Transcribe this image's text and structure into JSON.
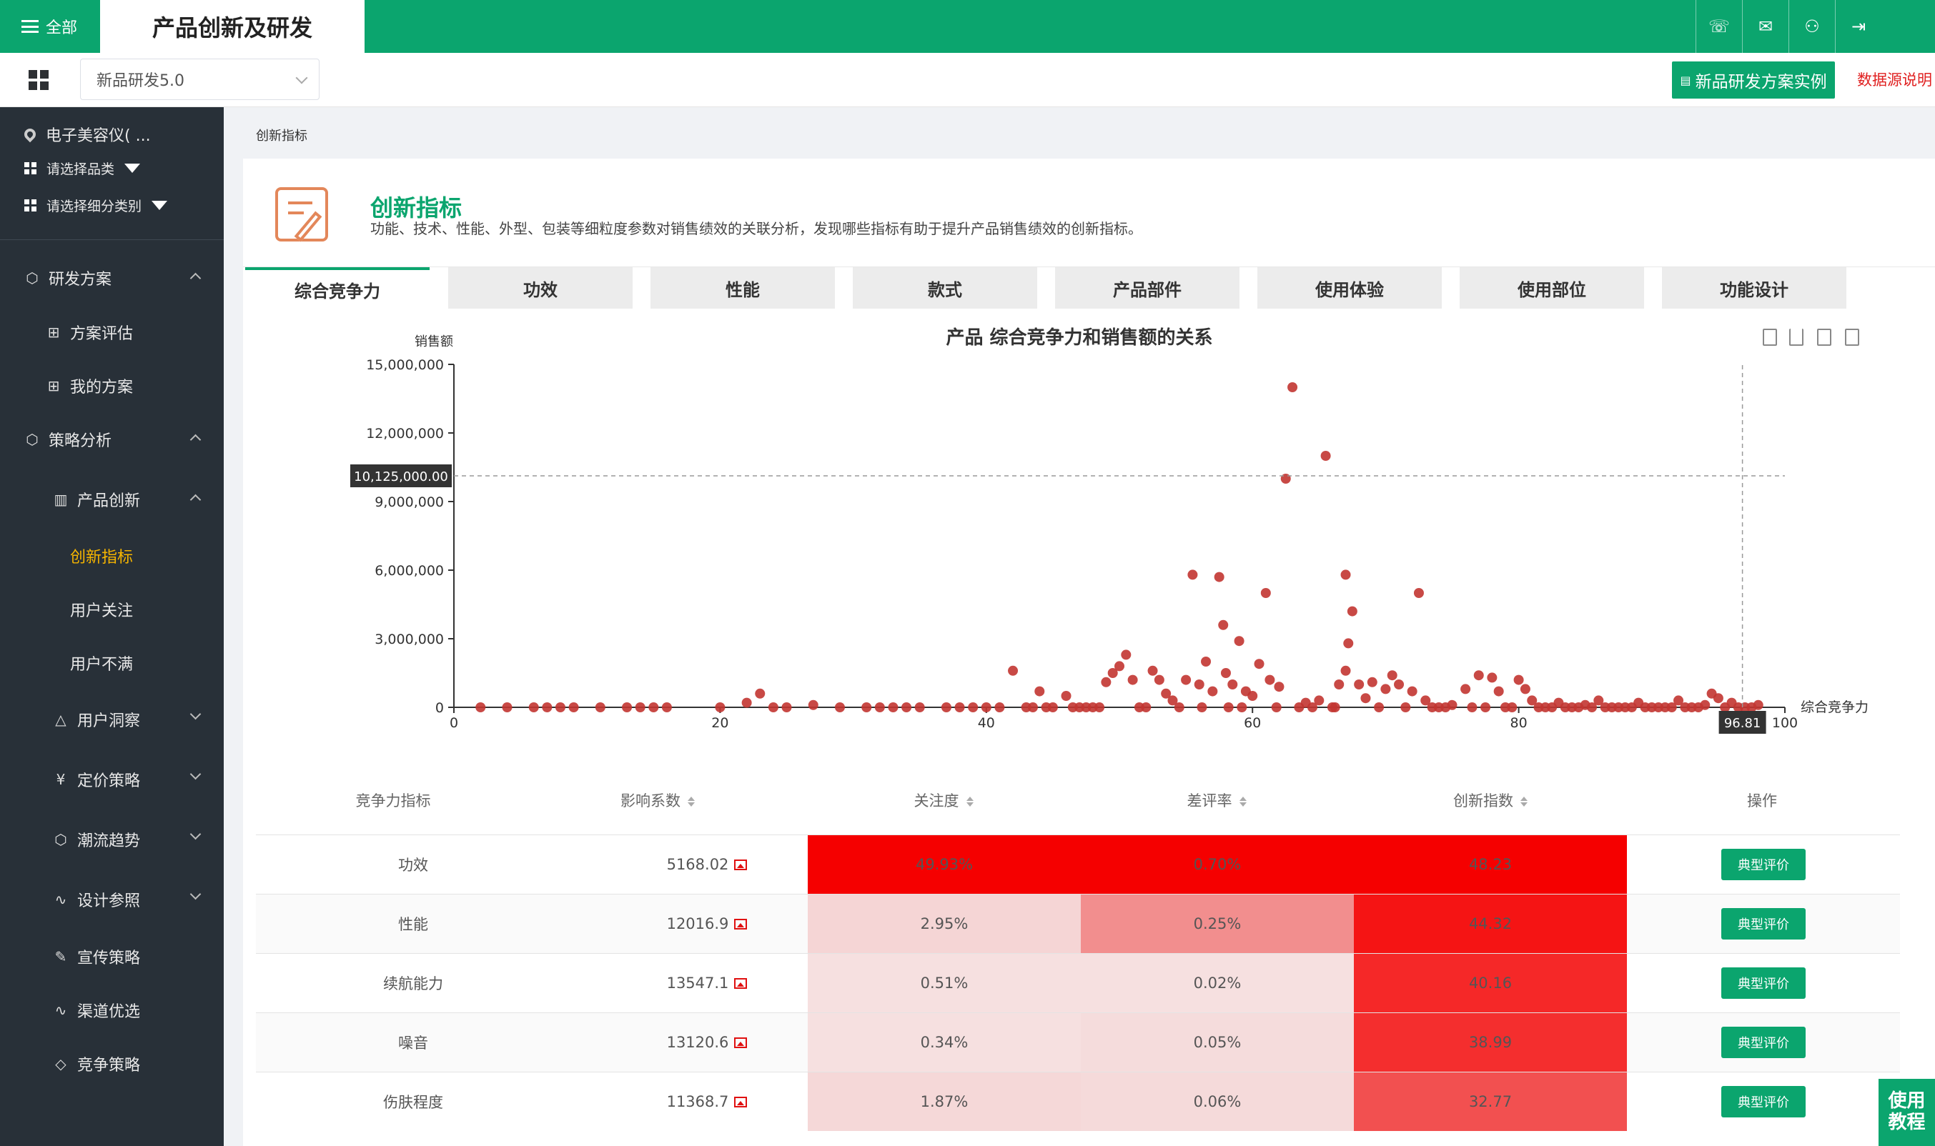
{
  "topbar": {
    "all_label": "全部",
    "app_title": "产品创新及研发",
    "icons": [
      "phone-icon",
      "wechat-icon",
      "user-icon",
      "logout-icon"
    ]
  },
  "subbar": {
    "version_value": "新品研发5.0",
    "case_button": "新品研发方案实例",
    "datasrc_link": "数据源说明"
  },
  "sidebar": {
    "location": "电子美容仪( ...",
    "select_category": "请选择品类",
    "select_subcategory": "请选择细分类别",
    "items": [
      {
        "label": "研发方案",
        "level": 1
      },
      {
        "label": "方案评估",
        "level": 2
      },
      {
        "label": "我的方案",
        "level": 2
      },
      {
        "label": "策略分析",
        "level": 1
      },
      {
        "label": "产品创新",
        "level": 2
      },
      {
        "label": "创新指标",
        "level": 3
      },
      {
        "label": "用户关注",
        "level": 3
      },
      {
        "label": "用户不满",
        "level": 3
      },
      {
        "label": "用户洞察",
        "level": 1
      },
      {
        "label": "定价策略",
        "level": 1
      },
      {
        "label": "潮流趋势",
        "level": 1
      },
      {
        "label": "设计参照",
        "level": 1
      },
      {
        "label": "宣传策略",
        "level": 1
      },
      {
        "label": "渠道优选",
        "level": 1
      },
      {
        "label": "竞争策略",
        "level": 1
      }
    ]
  },
  "page": {
    "breadcrumb": "创新指标",
    "title": "创新指标",
    "description": "功能、技术、性能、外型、包装等细粒度参数对销售绩效的关联分析，发现哪些指标有助于提升产品销售绩效的创新指标。",
    "tabs": [
      "综合竞争力",
      "功效",
      "性能",
      "款式",
      "产品部件",
      "使用体验",
      "使用部位",
      "功能设计"
    ],
    "active_tab": 0
  },
  "chart_data": {
    "type": "scatter",
    "title": "产品 综合竞争力和销售额的关系",
    "xlabel": "综合竞争力",
    "ylabel": "销售额",
    "xlim": [
      0,
      100
    ],
    "ylim": [
      0,
      15000000
    ],
    "xticks": [
      "0",
      "20",
      "40",
      "60",
      "80",
      "100"
    ],
    "yticks": [
      "0",
      "3,000,000",
      "6,000,000",
      "9,000,000",
      "12,000,000",
      "15,000,000"
    ],
    "crosshair": {
      "x_label": "96.81",
      "y_label": "10,125,000.00",
      "x": 96.81,
      "y": 10125000
    },
    "color": "#c23531",
    "points": [
      [
        2,
        0
      ],
      [
        4,
        0
      ],
      [
        6,
        0
      ],
      [
        7,
        0
      ],
      [
        8,
        0
      ],
      [
        9,
        0
      ],
      [
        11,
        0
      ],
      [
        13,
        0
      ],
      [
        14,
        0
      ],
      [
        15,
        0
      ],
      [
        16,
        0
      ],
      [
        20,
        0
      ],
      [
        22,
        200000
      ],
      [
        23,
        600000
      ],
      [
        24,
        0
      ],
      [
        25,
        0
      ],
      [
        27,
        100000
      ],
      [
        29,
        0
      ],
      [
        31,
        0
      ],
      [
        32,
        0
      ],
      [
        33,
        0
      ],
      [
        34,
        0
      ],
      [
        35,
        0
      ],
      [
        37,
        0
      ],
      [
        38,
        0
      ],
      [
        39,
        0
      ],
      [
        40,
        0
      ],
      [
        42,
        1600000
      ],
      [
        43,
        0
      ],
      [
        44,
        700000
      ],
      [
        45,
        0
      ],
      [
        46,
        500000
      ],
      [
        47,
        0
      ],
      [
        48,
        0
      ],
      [
        49,
        1100000
      ],
      [
        49.5,
        1500000
      ],
      [
        50,
        1800000
      ],
      [
        50.5,
        2300000
      ],
      [
        51,
        1200000
      ],
      [
        52,
        0
      ],
      [
        52.5,
        1600000
      ],
      [
        53,
        1200000
      ],
      [
        53.5,
        600000
      ],
      [
        54,
        300000
      ],
      [
        55,
        1200000
      ],
      [
        55.5,
        5800000
      ],
      [
        56,
        1000000
      ],
      [
        56.5,
        2000000
      ],
      [
        57,
        700000
      ],
      [
        57.5,
        5700000
      ],
      [
        57.8,
        3600000
      ],
      [
        58,
        1500000
      ],
      [
        58.5,
        1000000
      ],
      [
        59,
        2900000
      ],
      [
        59.5,
        700000
      ],
      [
        60,
        500000
      ],
      [
        60.5,
        1900000
      ],
      [
        61,
        5000000
      ],
      [
        61.3,
        1200000
      ],
      [
        62,
        900000
      ],
      [
        62.5,
        10000000
      ],
      [
        63,
        14000000
      ],
      [
        64,
        200000
      ],
      [
        65,
        300000
      ],
      [
        65.5,
        11000000
      ],
      [
        66,
        0
      ],
      [
        66.5,
        1000000
      ],
      [
        67,
        5800000
      ],
      [
        67.2,
        2800000
      ],
      [
        67.5,
        4200000
      ],
      [
        67,
        1600000
      ],
      [
        68,
        1000000
      ],
      [
        68.5,
        400000
      ],
      [
        69,
        1100000
      ],
      [
        70,
        800000
      ],
      [
        70.5,
        1400000
      ],
      [
        71,
        1000000
      ],
      [
        72,
        700000
      ],
      [
        72.5,
        5000000
      ],
      [
        73,
        300000
      ],
      [
        75,
        100000
      ],
      [
        76,
        800000
      ],
      [
        77,
        1400000
      ],
      [
        78,
        1300000
      ],
      [
        78.5,
        700000
      ],
      [
        79,
        0
      ],
      [
        80,
        1200000
      ],
      [
        80.5,
        800000
      ],
      [
        81,
        300000
      ],
      [
        82,
        0
      ],
      [
        83,
        200000
      ],
      [
        84,
        0
      ],
      [
        85,
        100000
      ],
      [
        86,
        300000
      ],
      [
        87,
        0
      ],
      [
        88,
        0
      ],
      [
        89,
        200000
      ],
      [
        90,
        0
      ],
      [
        91,
        0
      ],
      [
        92,
        300000
      ],
      [
        93,
        0
      ],
      [
        94,
        100000
      ],
      [
        94.5,
        600000
      ],
      [
        95,
        400000
      ],
      [
        96,
        200000
      ],
      [
        97,
        0
      ],
      [
        98,
        100000
      ],
      [
        41,
        0
      ],
      [
        43.5,
        0
      ],
      [
        44.5,
        0
      ],
      [
        46.5,
        0
      ],
      [
        47.5,
        0
      ],
      [
        48.5,
        0
      ],
      [
        51.5,
        0
      ],
      [
        54.5,
        0
      ],
      [
        56.2,
        0
      ],
      [
        58.2,
        0
      ],
      [
        59.2,
        0
      ],
      [
        61.8,
        0
      ],
      [
        63.5,
        0
      ],
      [
        64.5,
        0
      ],
      [
        66.2,
        0
      ],
      [
        69.5,
        0
      ],
      [
        71.5,
        0
      ],
      [
        73.5,
        0
      ],
      [
        74,
        0
      ],
      [
        74.5,
        0
      ],
      [
        76.5,
        0
      ],
      [
        77.5,
        0
      ],
      [
        79.5,
        0
      ],
      [
        81.5,
        0
      ],
      [
        82.5,
        0
      ],
      [
        83.5,
        0
      ],
      [
        84.5,
        0
      ],
      [
        85.5,
        0
      ],
      [
        86.5,
        0
      ],
      [
        87.5,
        0
      ],
      [
        88.5,
        0
      ],
      [
        89.5,
        0
      ],
      [
        90.5,
        0
      ],
      [
        91.5,
        0
      ],
      [
        92.5,
        0
      ],
      [
        93.5,
        0
      ],
      [
        95.5,
        0
      ],
      [
        96.5,
        0
      ],
      [
        97.5,
        0
      ]
    ]
  },
  "table": {
    "headers": [
      "竞争力指标",
      "影响系数",
      "关注度",
      "差评率",
      "创新指数",
      "操作"
    ],
    "sortable": [
      false,
      true,
      true,
      true,
      true,
      false
    ],
    "rows": [
      {
        "name": "功效",
        "coef": "5168.02",
        "attention": "49.93%",
        "neg": "0.70%",
        "index": "48.23",
        "op": "典型评价",
        "c1": "#f50000",
        "c2": "#f50000",
        "c3": "#f50000"
      },
      {
        "name": "性能",
        "coef": "12016.9",
        "attention": "2.95%",
        "neg": "0.25%",
        "index": "44.32",
        "op": "典型评价",
        "c1": "#f5d5d5",
        "c2": "#f28e8e",
        "c3": "#f51414"
      },
      {
        "name": "续航能力",
        "coef": "13547.1",
        "attention": "0.51%",
        "neg": "0.02%",
        "index": "40.16",
        "op": "典型评价",
        "c1": "#f6e0e0",
        "c2": "#f6e0e0",
        "c3": "#f52828"
      },
      {
        "name": "噪音",
        "coef": "13120.6",
        "attention": "0.34%",
        "neg": "0.05%",
        "index": "38.99",
        "op": "典型评价",
        "c1": "#f6e0e0",
        "c2": "#f5dcdc",
        "c3": "#f42e2e"
      },
      {
        "name": "伤肤程度",
        "coef": "11368.7",
        "attention": "1.87%",
        "neg": "0.06%",
        "index": "32.77",
        "op": "典型评价",
        "c1": "#f5d8d8",
        "c2": "#f5dada",
        "c3": "#f25050"
      }
    ]
  },
  "help": {
    "label1": "使用",
    "label2": "教程"
  }
}
